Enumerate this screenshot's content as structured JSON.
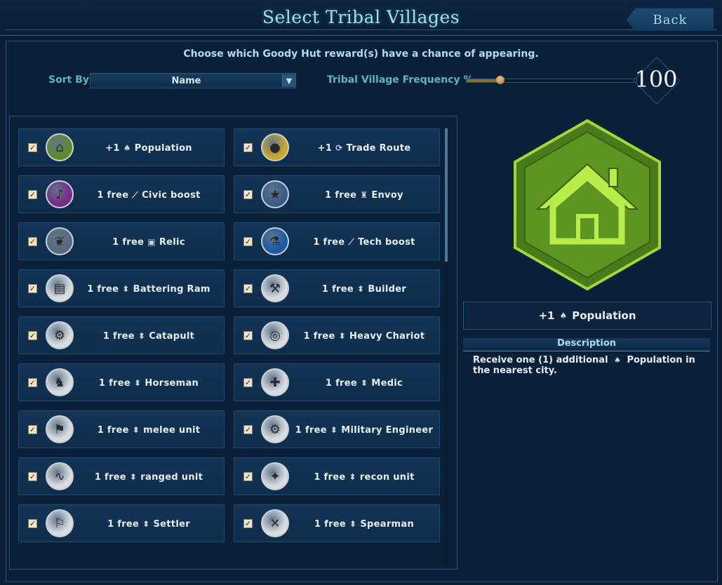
{
  "header": {
    "title": "Select Tribal Villages",
    "back_label": "Back"
  },
  "instructions": "Choose which Goody Hut reward(s) have a chance of appearing.",
  "sort": {
    "label": "Sort By:",
    "value": "Name"
  },
  "frequency": {
    "label": "Tribal Village Frequency %",
    "value": "100",
    "slider_fraction": 0.2
  },
  "rewards": [
    {
      "prefix": "+1",
      "glyph": "♠",
      "name": "Population",
      "icon": "house-icon",
      "icon_bg": "#5f8a28",
      "checked": true
    },
    {
      "prefix": "+1",
      "glyph": "⟳",
      "name": "Trade Route",
      "icon": "coin-icon",
      "icon_bg": "#c9a82a",
      "checked": true
    },
    {
      "prefix": "1 free",
      "glyph": "⟋",
      "name": "Civic boost",
      "icon": "music-note-icon",
      "icon_bg": "#7a2a8a",
      "checked": true
    },
    {
      "prefix": "1 free",
      "glyph": "♜",
      "name": "Envoy",
      "icon": "star-icon",
      "icon_bg": "#3a5a8a",
      "checked": true
    },
    {
      "prefix": "1 free",
      "glyph": "▣",
      "name": "Relic",
      "icon": "wings-icon",
      "icon_bg": "#5a6a7a",
      "checked": true
    },
    {
      "prefix": "1 free",
      "glyph": "⟋",
      "name": "Tech boost",
      "icon": "flask-icon",
      "icon_bg": "#1a5aa8",
      "checked": true
    },
    {
      "prefix": "1 free",
      "glyph": "⬍",
      "name": "Battering Ram",
      "icon": "battering-ram-icon",
      "icon_bg": "#d8dce0",
      "checked": true
    },
    {
      "prefix": "1 free",
      "glyph": "⬍",
      "name": "Builder",
      "icon": "builder-icon",
      "icon_bg": "#d8dce0",
      "checked": true
    },
    {
      "prefix": "1 free",
      "glyph": "⬍",
      "name": "Catapult",
      "icon": "catapult-icon",
      "icon_bg": "#d8dce0",
      "checked": true
    },
    {
      "prefix": "1 free",
      "glyph": "⬍",
      "name": "Heavy Chariot",
      "icon": "chariot-icon",
      "icon_bg": "#d8dce0",
      "checked": true
    },
    {
      "prefix": "1 free",
      "glyph": "⬍",
      "name": "Horseman",
      "icon": "horse-icon",
      "icon_bg": "#d8dce0",
      "checked": true
    },
    {
      "prefix": "1 free",
      "glyph": "⬍",
      "name": "Medic",
      "icon": "medic-cross-icon",
      "icon_bg": "#d8dce0",
      "checked": true
    },
    {
      "prefix": "1 free",
      "glyph": "⬍",
      "name": "melee unit",
      "icon": "club-icon",
      "icon_bg": "#d8dce0",
      "checked": true
    },
    {
      "prefix": "1 free",
      "glyph": "⬍",
      "name": "Military Engineer",
      "icon": "compass-icon",
      "icon_bg": "#d8dce0",
      "checked": true
    },
    {
      "prefix": "1 free",
      "glyph": "⬍",
      "name": "ranged unit",
      "icon": "sling-icon",
      "icon_bg": "#d8dce0",
      "checked": true
    },
    {
      "prefix": "1 free",
      "glyph": "⬍",
      "name": "recon unit",
      "icon": "wolf-icon",
      "icon_bg": "#d8dce0",
      "checked": true
    },
    {
      "prefix": "1 free",
      "glyph": "⬍",
      "name": "Settler",
      "icon": "flag-icon",
      "icon_bg": "#d8dce0",
      "checked": true
    },
    {
      "prefix": "1 free",
      "glyph": "⬍",
      "name": "Spearman",
      "icon": "crossed-spears-icon",
      "icon_bg": "#d8dce0",
      "checked": true
    }
  ],
  "detail": {
    "title_prefix": "+1",
    "title_glyph": "♠",
    "title_name": "Population",
    "description_header": "Description",
    "description_pre": "Receive one (1) additional",
    "description_glyph": "♠",
    "description_post": "Population in the nearest city.",
    "accent": "#7fbf2a"
  }
}
